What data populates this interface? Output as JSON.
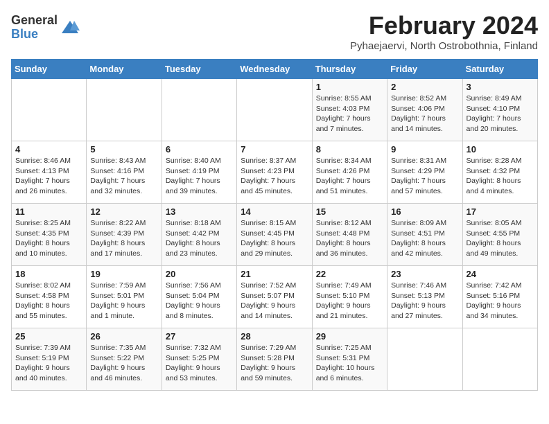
{
  "logo": {
    "general": "General",
    "blue": "Blue"
  },
  "title": {
    "month_year": "February 2024",
    "location": "Pyhaejaervi, North Ostrobothnia, Finland"
  },
  "days_of_week": [
    "Sunday",
    "Monday",
    "Tuesday",
    "Wednesday",
    "Thursday",
    "Friday",
    "Saturday"
  ],
  "weeks": [
    [
      {
        "day": "",
        "info": ""
      },
      {
        "day": "",
        "info": ""
      },
      {
        "day": "",
        "info": ""
      },
      {
        "day": "",
        "info": ""
      },
      {
        "day": "1",
        "info": "Sunrise: 8:55 AM\nSunset: 4:03 PM\nDaylight: 7 hours\nand 7 minutes."
      },
      {
        "day": "2",
        "info": "Sunrise: 8:52 AM\nSunset: 4:06 PM\nDaylight: 7 hours\nand 14 minutes."
      },
      {
        "day": "3",
        "info": "Sunrise: 8:49 AM\nSunset: 4:10 PM\nDaylight: 7 hours\nand 20 minutes."
      }
    ],
    [
      {
        "day": "4",
        "info": "Sunrise: 8:46 AM\nSunset: 4:13 PM\nDaylight: 7 hours\nand 26 minutes."
      },
      {
        "day": "5",
        "info": "Sunrise: 8:43 AM\nSunset: 4:16 PM\nDaylight: 7 hours\nand 32 minutes."
      },
      {
        "day": "6",
        "info": "Sunrise: 8:40 AM\nSunset: 4:19 PM\nDaylight: 7 hours\nand 39 minutes."
      },
      {
        "day": "7",
        "info": "Sunrise: 8:37 AM\nSunset: 4:23 PM\nDaylight: 7 hours\nand 45 minutes."
      },
      {
        "day": "8",
        "info": "Sunrise: 8:34 AM\nSunset: 4:26 PM\nDaylight: 7 hours\nand 51 minutes."
      },
      {
        "day": "9",
        "info": "Sunrise: 8:31 AM\nSunset: 4:29 PM\nDaylight: 7 hours\nand 57 minutes."
      },
      {
        "day": "10",
        "info": "Sunrise: 8:28 AM\nSunset: 4:32 PM\nDaylight: 8 hours\nand 4 minutes."
      }
    ],
    [
      {
        "day": "11",
        "info": "Sunrise: 8:25 AM\nSunset: 4:35 PM\nDaylight: 8 hours\nand 10 minutes."
      },
      {
        "day": "12",
        "info": "Sunrise: 8:22 AM\nSunset: 4:39 PM\nDaylight: 8 hours\nand 17 minutes."
      },
      {
        "day": "13",
        "info": "Sunrise: 8:18 AM\nSunset: 4:42 PM\nDaylight: 8 hours\nand 23 minutes."
      },
      {
        "day": "14",
        "info": "Sunrise: 8:15 AM\nSunset: 4:45 PM\nDaylight: 8 hours\nand 29 minutes."
      },
      {
        "day": "15",
        "info": "Sunrise: 8:12 AM\nSunset: 4:48 PM\nDaylight: 8 hours\nand 36 minutes."
      },
      {
        "day": "16",
        "info": "Sunrise: 8:09 AM\nSunset: 4:51 PM\nDaylight: 8 hours\nand 42 minutes."
      },
      {
        "day": "17",
        "info": "Sunrise: 8:05 AM\nSunset: 4:55 PM\nDaylight: 8 hours\nand 49 minutes."
      }
    ],
    [
      {
        "day": "18",
        "info": "Sunrise: 8:02 AM\nSunset: 4:58 PM\nDaylight: 8 hours\nand 55 minutes."
      },
      {
        "day": "19",
        "info": "Sunrise: 7:59 AM\nSunset: 5:01 PM\nDaylight: 9 hours\nand 1 minute."
      },
      {
        "day": "20",
        "info": "Sunrise: 7:56 AM\nSunset: 5:04 PM\nDaylight: 9 hours\nand 8 minutes."
      },
      {
        "day": "21",
        "info": "Sunrise: 7:52 AM\nSunset: 5:07 PM\nDaylight: 9 hours\nand 14 minutes."
      },
      {
        "day": "22",
        "info": "Sunrise: 7:49 AM\nSunset: 5:10 PM\nDaylight: 9 hours\nand 21 minutes."
      },
      {
        "day": "23",
        "info": "Sunrise: 7:46 AM\nSunset: 5:13 PM\nDaylight: 9 hours\nand 27 minutes."
      },
      {
        "day": "24",
        "info": "Sunrise: 7:42 AM\nSunset: 5:16 PM\nDaylight: 9 hours\nand 34 minutes."
      }
    ],
    [
      {
        "day": "25",
        "info": "Sunrise: 7:39 AM\nSunset: 5:19 PM\nDaylight: 9 hours\nand 40 minutes."
      },
      {
        "day": "26",
        "info": "Sunrise: 7:35 AM\nSunset: 5:22 PM\nDaylight: 9 hours\nand 46 minutes."
      },
      {
        "day": "27",
        "info": "Sunrise: 7:32 AM\nSunset: 5:25 PM\nDaylight: 9 hours\nand 53 minutes."
      },
      {
        "day": "28",
        "info": "Sunrise: 7:29 AM\nSunset: 5:28 PM\nDaylight: 9 hours\nand 59 minutes."
      },
      {
        "day": "29",
        "info": "Sunrise: 7:25 AM\nSunset: 5:31 PM\nDaylight: 10 hours\nand 6 minutes."
      },
      {
        "day": "",
        "info": ""
      },
      {
        "day": "",
        "info": ""
      }
    ]
  ]
}
